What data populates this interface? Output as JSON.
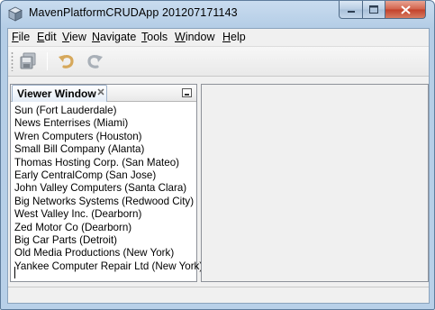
{
  "window": {
    "title": "MavenPlatformCRUDApp 201207171143"
  },
  "menubar": {
    "items": [
      {
        "underline": "F",
        "rest": "ile"
      },
      {
        "underline": "E",
        "rest": "dit"
      },
      {
        "underline": "V",
        "rest": "iew"
      },
      {
        "underline": "N",
        "rest": "avigate"
      },
      {
        "underline": "T",
        "rest": "ools"
      },
      {
        "underline": "W",
        "rest": "indow"
      },
      {
        "underline": "H",
        "rest": "elp"
      }
    ]
  },
  "toolbar": {
    "buttons": [
      "save-all-icon",
      "undo-icon",
      "redo-icon"
    ]
  },
  "viewer": {
    "tab_label": "Viewer Window",
    "items": [
      "Sun (Fort Lauderdale)",
      "News Enterrises (Miami)",
      "Wren Computers (Houston)",
      "Small Bill Company (Alanta)",
      "Thomas Hosting Corp. (San Mateo)",
      "Early CentralComp (San Jose)",
      "John Valley Computers (Santa Clara)",
      "Big Networks Systems (Redwood City)",
      "West Valley Inc. (Dearborn)",
      "Zed Motor Co (Dearborn)",
      "Big Car Parts (Detroit)",
      "Old Media Productions (New York)",
      "Yankee Computer Repair Ltd (New York)"
    ]
  },
  "colors": {
    "title_bar": "#b8d0e8",
    "close_button": "#c2412a",
    "client_bg": "#f0f0f0"
  }
}
